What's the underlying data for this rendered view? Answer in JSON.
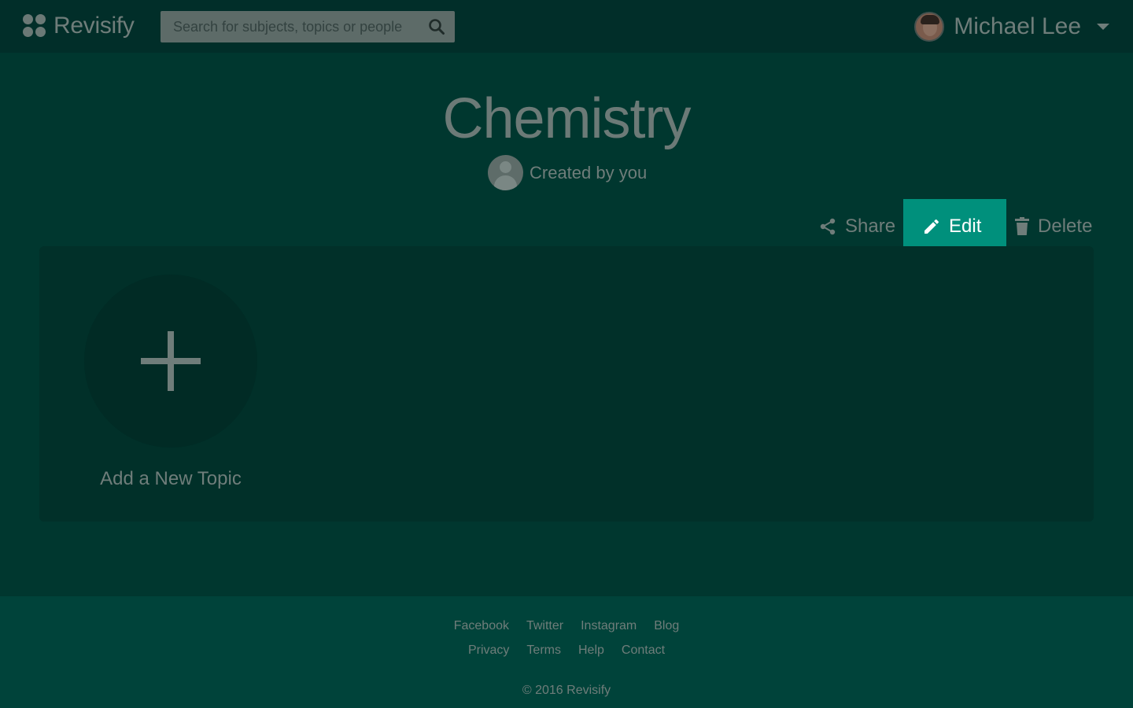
{
  "header": {
    "logo_text": "Revisify",
    "search_placeholder": "Search for subjects, topics or people",
    "user_name": "Michael Lee"
  },
  "subject": {
    "title": "Chemistry",
    "creator_text": "Created by you"
  },
  "actions": {
    "share_label": "Share",
    "edit_label": "Edit",
    "delete_label": "Delete"
  },
  "topics": {
    "add_label": "Add a New Topic"
  },
  "footer": {
    "row1": [
      "Facebook",
      "Twitter",
      "Instagram",
      "Blog"
    ],
    "row2": [
      "Privacy",
      "Terms",
      "Help",
      "Contact"
    ],
    "copyright": "© 2016 Revisify"
  },
  "colors": {
    "accent": "#00907c",
    "background": "#00372f",
    "header": "#012e29",
    "footer": "#00433a"
  }
}
